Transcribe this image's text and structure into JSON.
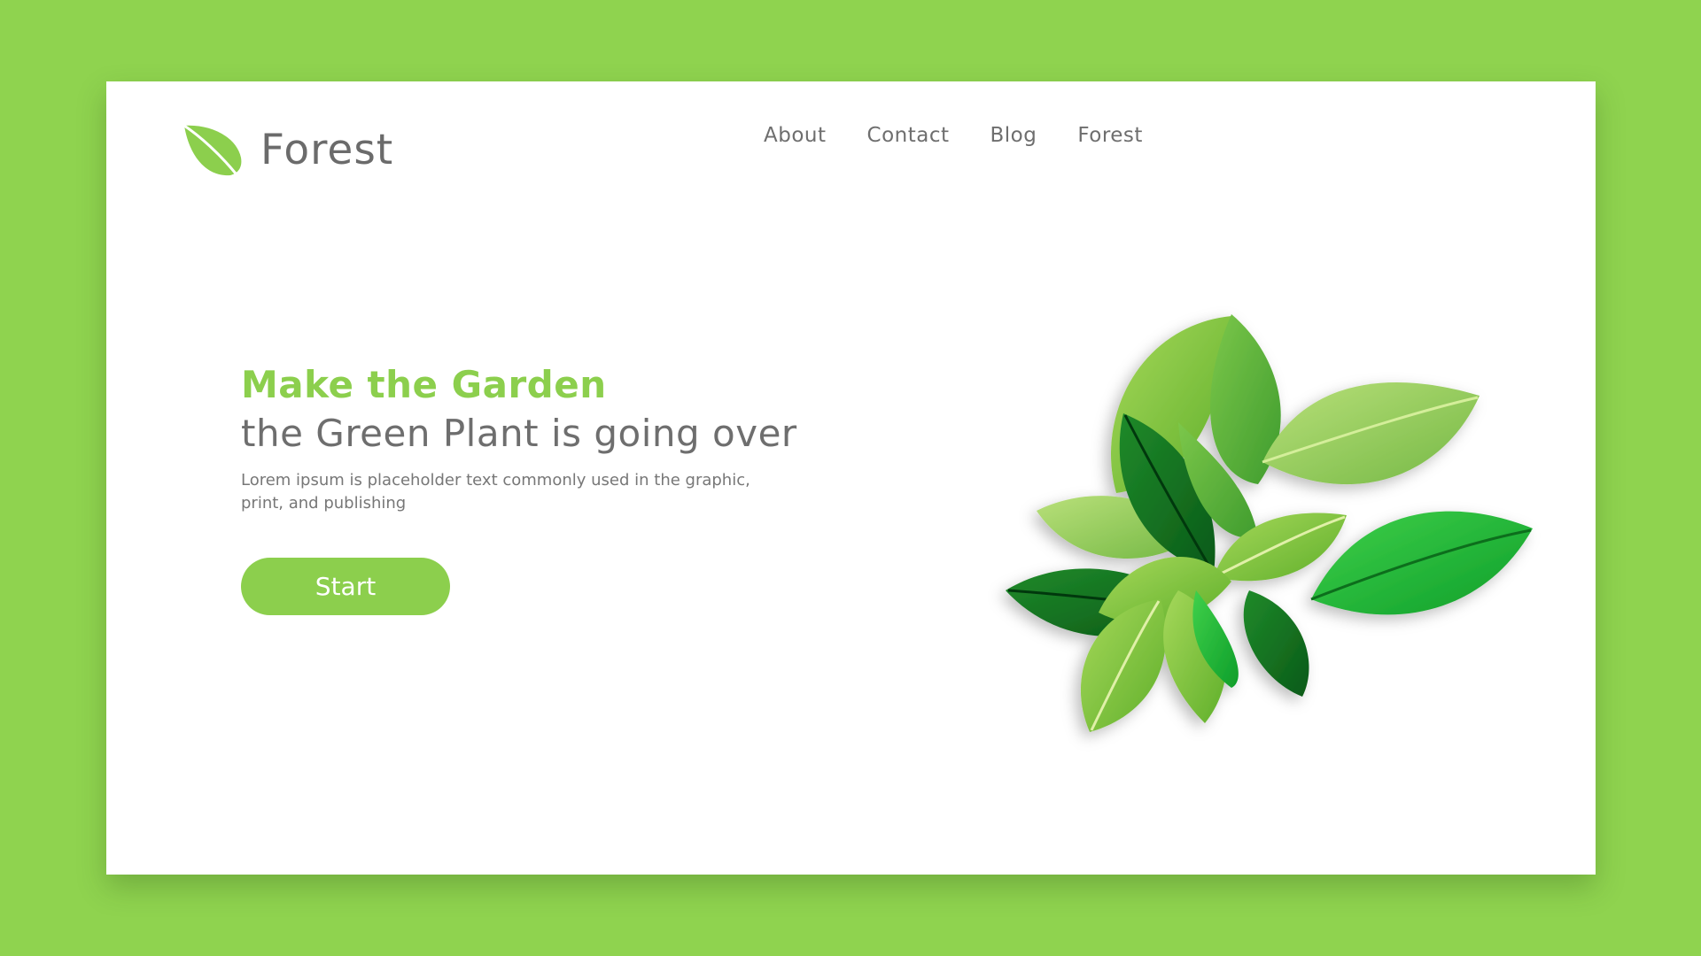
{
  "brand": {
    "name": "Forest",
    "icon": "leaf-icon",
    "color": "#8ccf4d"
  },
  "nav": {
    "items": [
      {
        "label": "About"
      },
      {
        "label": "Contact"
      },
      {
        "label": "Blog"
      },
      {
        "label": "Forest"
      }
    ]
  },
  "hero": {
    "title": "Make the Garden",
    "subtitle": "the Green Plant is going over",
    "description": "Lorem ipsum is placeholder text commonly used in the graphic, print, and publishing",
    "button_label": "Start"
  },
  "illustration": {
    "icon": "leaf-cluster-illustration"
  },
  "colors": {
    "background": "#8fd34f",
    "card": "#ffffff",
    "accent": "#8ccf4d",
    "text": "#6e6e6e"
  }
}
